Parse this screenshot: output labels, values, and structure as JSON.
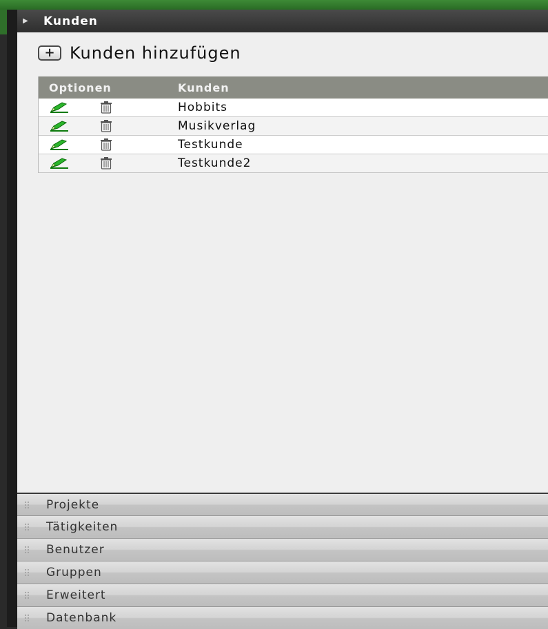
{
  "header": {
    "title": "Kunden"
  },
  "toolbar": {
    "add_label": "Kunden hinzufügen",
    "add_icon_glyph": "+"
  },
  "table": {
    "columns": [
      "Optionen",
      "Kunden"
    ],
    "rows": [
      {
        "name": "Hobbits"
      },
      {
        "name": "Musikverlag"
      },
      {
        "name": "Testkunde"
      },
      {
        "name": "Testkunde2"
      }
    ]
  },
  "accordion": {
    "items": [
      {
        "label": "Projekte"
      },
      {
        "label": "Tätigkeiten"
      },
      {
        "label": "Benutzer"
      },
      {
        "label": "Gruppen"
      },
      {
        "label": "Erweitert"
      },
      {
        "label": "Datenbank"
      }
    ]
  },
  "icons": {
    "header_toggle": "triangle-right-icon",
    "edit": "pencil-icon",
    "delete": "trash-icon",
    "grip": "grip-dots-icon"
  },
  "colors": {
    "header_bg": "#3a3a3a",
    "table_header_bg": "#8a8c84",
    "panel_bg": "#efefef",
    "edit_icon": "#2bb52b",
    "top_strip": "#3d8a36"
  }
}
